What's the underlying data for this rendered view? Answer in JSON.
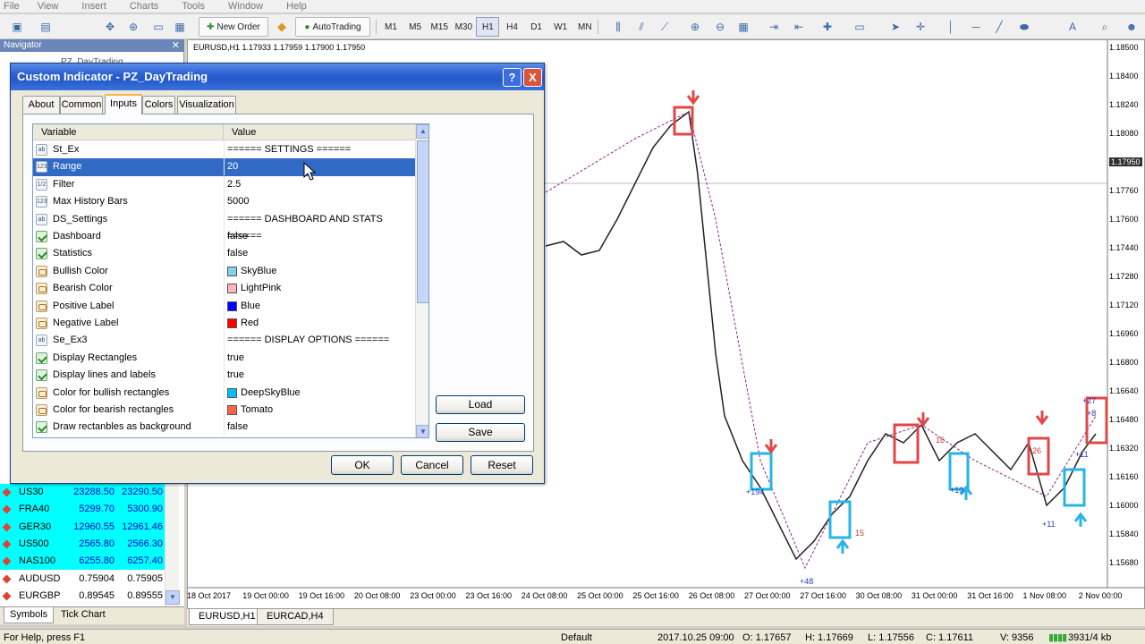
{
  "menu": [
    "File",
    "View",
    "Insert",
    "Charts",
    "Tools",
    "Window",
    "Help"
  ],
  "toolbar": {
    "new_order": "New Order",
    "autotrading": "AutoTrading",
    "timeframes": [
      "M1",
      "M5",
      "M15",
      "M30",
      "H1",
      "H4",
      "D1",
      "W1",
      "MN"
    ],
    "active_timeframe": "H1"
  },
  "navigator": {
    "title": "Navigator",
    "item": "PZ_DayTrading"
  },
  "chart": {
    "header": "EURUSD,H1  1.17933 1.17959 1.17900 1.17950",
    "price_axis": [
      "1.18500",
      "1.18400",
      "1.18240",
      "1.18080",
      "1.17950",
      "1.17760",
      "1.17600",
      "1.17440",
      "1.17280",
      "1.17120",
      "1.16960",
      "1.16800",
      "1.16640",
      "1.16480",
      "1.16320",
      "1.16160",
      "1.16000",
      "1.15840",
      "1.15680"
    ],
    "current_price": "1.17950",
    "time_axis": [
      "18 Oct 2017",
      "19 Oct 00:00",
      "19 Oct 16:00",
      "20 Oct 08:00",
      "23 Oct 00:00",
      "23 Oct 16:00",
      "24 Oct 08:00",
      "25 Oct 00:00",
      "25 Oct 16:00",
      "26 Oct 08:00",
      "27 Oct 00:00",
      "27 Oct 16:00",
      "30 Oct 08:00",
      "31 Oct 00:00",
      "31 Oct 16:00",
      "1 Nov 08:00",
      "2 Nov 00:00"
    ],
    "labels": [
      "+194",
      "+48",
      "15",
      "+10",
      "16",
      "26",
      "+11",
      "+27",
      "+11",
      "+8"
    ],
    "bull_color": "#27b4e6",
    "bear_color": "#e04848"
  },
  "dialog": {
    "title": "Custom Indicator - PZ_DayTrading",
    "help_label": "?",
    "close_label": "X",
    "tabs": [
      "About",
      "Common",
      "Inputs",
      "Colors",
      "Visualization"
    ],
    "active_tab": "Inputs",
    "columns": {
      "variable": "Variable",
      "value": "Value"
    },
    "rows": [
      {
        "name": "St_Ex",
        "value": "====== SETTINGS ======",
        "icon": "ab",
        "type": "text"
      },
      {
        "name": "Range",
        "value": "20",
        "icon": "123",
        "type": "num"
      },
      {
        "name": "Filter",
        "value": "2.5",
        "icon": "1/2",
        "type": "num"
      },
      {
        "name": "Max History Bars",
        "value": "5000",
        "icon": "123",
        "type": "num"
      },
      {
        "name": "DS_Settings",
        "value": "====== DASHBOARD AND STATS ======",
        "icon": "ab",
        "type": "text"
      },
      {
        "name": "Dashboard",
        "value": "false",
        "icon": "",
        "type": "bool"
      },
      {
        "name": "Statistics",
        "value": "false",
        "icon": "",
        "type": "bool"
      },
      {
        "name": "Bullish Color",
        "value": "SkyBlue",
        "icon": "",
        "type": "color",
        "swatch": "#87ceeb"
      },
      {
        "name": "Bearish Color",
        "value": "LightPink",
        "icon": "",
        "type": "color",
        "swatch": "#ffb6c1"
      },
      {
        "name": "Positive Label",
        "value": "Blue",
        "icon": "",
        "type": "color",
        "swatch": "#0000ff"
      },
      {
        "name": "Negative Label",
        "value": "Red",
        "icon": "",
        "type": "color",
        "swatch": "#ff0000"
      },
      {
        "name": "Se_Ex3",
        "value": "====== DISPLAY OPTIONS ======",
        "icon": "ab",
        "type": "text"
      },
      {
        "name": "Display Rectangles",
        "value": "true",
        "icon": "",
        "type": "bool"
      },
      {
        "name": "Display lines and labels",
        "value": "true",
        "icon": "",
        "type": "bool"
      },
      {
        "name": "Color for bullish rectangles",
        "value": "DeepSkyBlue",
        "icon": "",
        "type": "color",
        "swatch": "#00bfff"
      },
      {
        "name": "Color for bearish rectangles",
        "value": "Tomato",
        "icon": "",
        "type": "color",
        "swatch": "#ff6347"
      },
      {
        "name": "Draw rectanbles as background",
        "value": "false",
        "icon": "",
        "type": "bool"
      }
    ],
    "selected_row": "Range",
    "buttons": {
      "load": "Load",
      "save": "Save",
      "ok": "OK",
      "cancel": "Cancel",
      "reset": "Reset"
    }
  },
  "market_watch": [
    {
      "symbol": "US30",
      "bid": "23288.50",
      "ask": "23290.50"
    },
    {
      "symbol": "FRA40",
      "bid": "5299.70",
      "ask": "5300.90"
    },
    {
      "symbol": "GER30",
      "bid": "12960.55",
      "ask": "12961.46"
    },
    {
      "symbol": "US500",
      "bid": "2565.80",
      "ask": "2566.30"
    },
    {
      "symbol": "NAS100",
      "bid": "6255.80",
      "ask": "6257.40"
    },
    {
      "symbol": "AUDUSD",
      "bid": "0.75904",
      "ask": "0.75905"
    },
    {
      "symbol": "EURGBP",
      "bid": "0.89545",
      "ask": "0.89555"
    }
  ],
  "symbol_tabs": [
    "Symbols",
    "Tick Chart"
  ],
  "chart_tabs": [
    "EURUSD,H1",
    "EURCAD,H4"
  ],
  "status": {
    "help": "For Help, press F1",
    "profile": "Default",
    "datetime": "2017.10.25 09:00",
    "open": "O: 1.17657",
    "high": "H: 1.17669",
    "low": "L: 1.17556",
    "close": "C: 1.17611",
    "volume": "V: 9356",
    "traffic": "3931/4 kb"
  }
}
